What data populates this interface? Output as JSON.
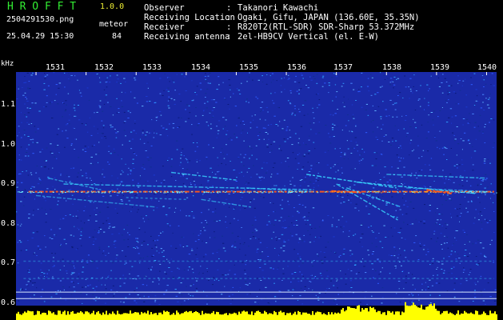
{
  "header": {
    "app_title": "H R O F F T",
    "version": "1.0.0",
    "filename": "2504291530.png",
    "detector_label": "meteor",
    "timestamp": "25.04.29 15:30",
    "meteor_count": "84",
    "fields": [
      {
        "label": "Observer",
        "value": "Takanori Kawachi"
      },
      {
        "label": "Receiving Location",
        "value": "Ogaki, Gifu, JAPAN (136.60E, 35.35N)"
      },
      {
        "label": "Receiver",
        "value": "R820T2(RTL-SDR) SDR-Sharp 53.372MHz"
      },
      {
        "label": "Receiving antenna",
        "value": "2el-HB9CV Vertical (el. E-W)"
      }
    ]
  },
  "colors": {
    "background": "#000000",
    "spectrogram_noise": "#1a2aa8",
    "trail_cyan": "#3ad6ff",
    "trail_hot": "#ff5a1a",
    "power_bar": "#ffff00",
    "tick_text": "#ffffff",
    "title_green": "#33ee33",
    "version_yellow": "#eeee33"
  },
  "chart_data": {
    "type": "heatmap",
    "ylabel": "kHz",
    "x_ticks": [
      "1531",
      "1532",
      "1533",
      "1534",
      "1535",
      "1536",
      "1537",
      "1538",
      "1539",
      "1540"
    ],
    "y_ticks": [
      "1.1",
      "1.0",
      "0.9",
      "0.8",
      "0.7",
      "0.6"
    ],
    "x_range": [
      1530.6,
      1540.2
    ],
    "y_range": [
      0.585,
      1.19
    ],
    "meteor_trails": [
      {
        "x": [
          1530.85,
          1540.15
        ],
        "y": [
          0.88,
          0.88
        ],
        "intensity": 0.95
      },
      {
        "x": [
          1531.55,
          1536.55
        ],
        "y": [
          0.9,
          0.885
        ],
        "intensity": 0.75
      },
      {
        "x": [
          1531.0,
          1533.4
        ],
        "y": [
          0.87,
          0.84
        ],
        "intensity": 0.55
      },
      {
        "x": [
          1531.25,
          1532.3
        ],
        "y": [
          0.915,
          0.885
        ],
        "intensity": 0.6
      },
      {
        "x": [
          1533.7,
          1535.0
        ],
        "y": [
          0.93,
          0.91
        ],
        "intensity": 0.8
      },
      {
        "x": [
          1534.3,
          1535.3
        ],
        "y": [
          0.86,
          0.84
        ],
        "intensity": 0.6
      },
      {
        "x": [
          1535.2,
          1536.5
        ],
        "y": [
          0.89,
          0.88
        ],
        "intensity": 0.6
      },
      {
        "x": [
          1536.4,
          1538.2
        ],
        "y": [
          0.925,
          0.89
        ],
        "intensity": 0.9
      },
      {
        "x": [
          1537.0,
          1538.25
        ],
        "y": [
          0.9,
          0.805
        ],
        "intensity": 0.8
      },
      {
        "x": [
          1537.2,
          1538.3
        ],
        "y": [
          0.89,
          0.84
        ],
        "intensity": 0.8
      },
      {
        "x": [
          1537.4,
          1539.8
        ],
        "y": [
          0.905,
          0.875
        ],
        "intensity": 0.9
      },
      {
        "x": [
          1538.0,
          1540.0
        ],
        "y": [
          0.925,
          0.915
        ],
        "intensity": 0.7
      },
      {
        "x": [
          1538.4,
          1540.05
        ],
        "y": [
          0.89,
          0.88
        ],
        "intensity": 0.6
      },
      {
        "x": [
          1538.8,
          1539.3
        ],
        "y": [
          0.885,
          0.875
        ],
        "intensity": 1.0
      },
      {
        "x": [
          1536.9,
          1537.5
        ],
        "y": [
          0.882,
          0.878
        ],
        "intensity": 1.0
      },
      {
        "x": [
          1532.8,
          1534.0
        ],
        "y": [
          0.865,
          0.86
        ],
        "intensity": 0.5
      },
      {
        "x": [
          1530.75,
          1540.15
        ],
        "y": [
          0.7,
          0.7
        ],
        "intensity": 0.25
      },
      {
        "x": [
          1530.75,
          1540.15
        ],
        "y": [
          0.655,
          0.655
        ],
        "intensity": 0.2
      }
    ],
    "grid": false,
    "legend": "none"
  }
}
